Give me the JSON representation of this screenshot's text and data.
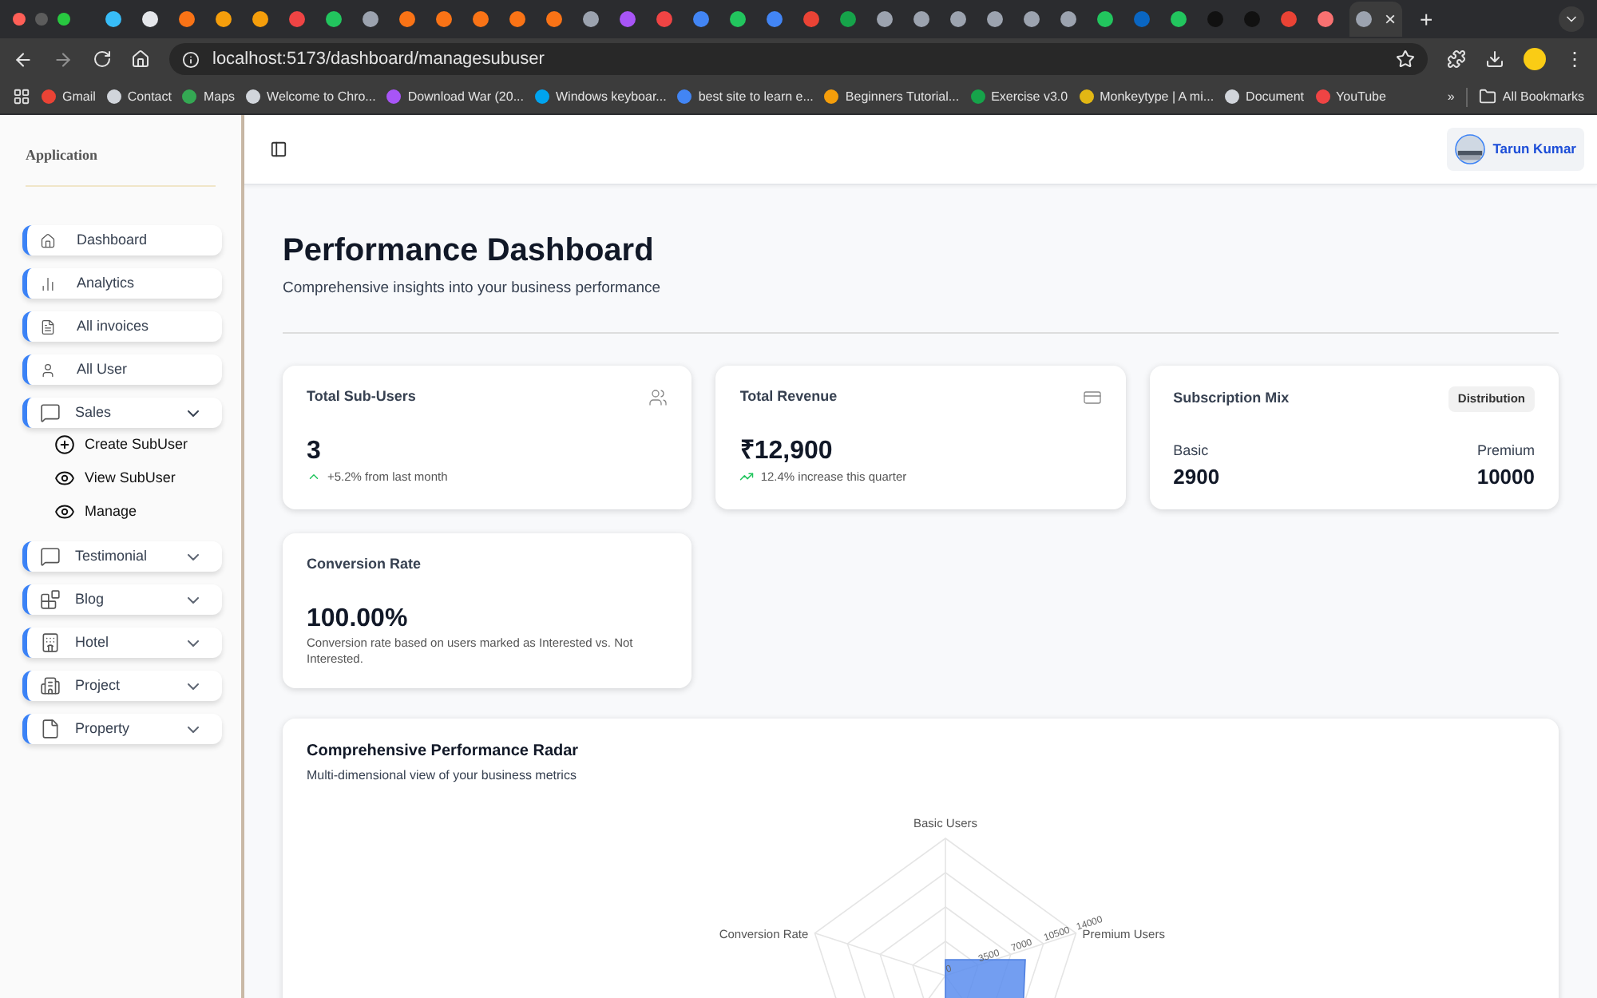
{
  "browser": {
    "tabs": [
      {
        "color": "#38bdf8",
        "selected": false
      },
      {
        "color": "#e5e7eb",
        "selected": false
      },
      {
        "color": "#f97316",
        "selected": false
      },
      {
        "color": "#f59e0b",
        "selected": false
      },
      {
        "color": "#f59e0b",
        "selected": false
      },
      {
        "color": "#ef4444",
        "selected": false
      },
      {
        "color": "#22c55e",
        "selected": false
      },
      {
        "color": "#9ca3af",
        "selected": false
      },
      {
        "color": "#f97316",
        "selected": false
      },
      {
        "color": "#f97316",
        "selected": false
      },
      {
        "color": "#f97316",
        "selected": false
      },
      {
        "color": "#f97316",
        "selected": false
      },
      {
        "color": "#f97316",
        "selected": false
      },
      {
        "color": "#9ca3af",
        "selected": false
      },
      {
        "color": "#a855f7",
        "selected": false
      },
      {
        "color": "#ef4444",
        "selected": false
      },
      {
        "color": "#4285f4",
        "selected": false
      },
      {
        "color": "#22c55e",
        "selected": false
      },
      {
        "color": "#4285f4",
        "selected": false
      },
      {
        "color": "#ea4335",
        "selected": false
      },
      {
        "color": "#16a34a",
        "selected": false
      },
      {
        "color": "#9ca3af",
        "selected": false
      },
      {
        "color": "#9ca3af",
        "selected": false
      },
      {
        "color": "#9ca3af",
        "selected": false
      },
      {
        "color": "#9ca3af",
        "selected": false
      },
      {
        "color": "#9ca3af",
        "selected": false
      },
      {
        "color": "#9ca3af",
        "selected": false
      },
      {
        "color": "#22c55e",
        "selected": false
      },
      {
        "color": "#0a66c2",
        "selected": false
      },
      {
        "color": "#22c55e",
        "selected": false
      },
      {
        "color": "#111111",
        "selected": false
      },
      {
        "color": "#111111",
        "selected": false
      },
      {
        "color": "#ea4335",
        "selected": false
      },
      {
        "color": "#f87171",
        "selected": false
      },
      {
        "color": "#9ca3af",
        "selected": true
      }
    ],
    "close_tab": "×",
    "new_tab": "+",
    "menu": "⋮",
    "url": "localhost:5173/dashboard/managesubuser",
    "bookmarks": [
      {
        "label": "Gmail",
        "color": "#ea4335"
      },
      {
        "label": "Contact",
        "color": "#d1d5db"
      },
      {
        "label": "Maps",
        "color": "#34a853"
      },
      {
        "label": "Welcome to Chro...",
        "color": "#d1d5db"
      },
      {
        "label": "Download War (20...",
        "color": "#a855f7"
      },
      {
        "label": "Windows keyboar...",
        "color": "#00a4ef"
      },
      {
        "label": "best site to learn e...",
        "color": "#4285f4"
      },
      {
        "label": "Beginners Tutorial...",
        "color": "#f59e0b"
      },
      {
        "label": "Exercise v3.0",
        "color": "#16a34a"
      },
      {
        "label": "Monkeytype | A mi...",
        "color": "#e2b714"
      },
      {
        "label": "Document",
        "color": "#d1d5db"
      },
      {
        "label": "YouTube",
        "color": "#ef4444"
      }
    ],
    "more": "»",
    "all_bookmarks": "All Bookmarks"
  },
  "sidebar": {
    "title": "Application",
    "items": [
      {
        "kind": "link",
        "label": "Dashboard"
      },
      {
        "kind": "link",
        "label": "Analytics"
      },
      {
        "kind": "link",
        "label": "All invoices"
      },
      {
        "kind": "link",
        "label": "All User"
      },
      {
        "kind": "group",
        "label": "Sales",
        "expanded": true,
        "children": [
          {
            "label": "Create SubUser"
          },
          {
            "label": "View SubUser"
          },
          {
            "label": "Manage"
          }
        ]
      },
      {
        "kind": "group",
        "label": "Testimonial",
        "expanded": false
      },
      {
        "kind": "group",
        "label": "Blog",
        "expanded": false
      },
      {
        "kind": "group",
        "label": "Hotel",
        "expanded": false
      },
      {
        "kind": "group",
        "label": "Project",
        "expanded": false
      },
      {
        "kind": "group",
        "label": "Property",
        "expanded": false
      }
    ]
  },
  "header": {
    "user": "Tarun Kumar"
  },
  "page": {
    "title": "Performance Dashboard",
    "subtitle": "Comprehensive insights into your business performance"
  },
  "cards": [
    {
      "kind": "stat",
      "title": "Total Sub-Users",
      "value": "3",
      "trend": "+5.2% from last month"
    },
    {
      "kind": "stat",
      "title": "Total Revenue",
      "value": "₹12,900",
      "trend": "12.4% increase this quarter"
    },
    {
      "kind": "mix",
      "title": "Subscription Mix",
      "badge": "Distribution",
      "left_label": "Basic",
      "left_value": "2900",
      "right_label": "Premium",
      "right_value": "10000"
    },
    {
      "kind": "stat",
      "title": "Conversion Rate",
      "value": "100.00%",
      "note": "Conversion rate based on users marked as Interested vs. Not Interested."
    }
  ],
  "radar": {
    "title": "Comprehensive Performance Radar",
    "subtitle": "Multi-dimensional view of your business metrics",
    "axis_labels": [
      "Basic Users",
      "Premium Users",
      "Conversion Rate"
    ],
    "tick_labels": [
      "0",
      "3500",
      "7000",
      "10500",
      "14000"
    ]
  }
}
